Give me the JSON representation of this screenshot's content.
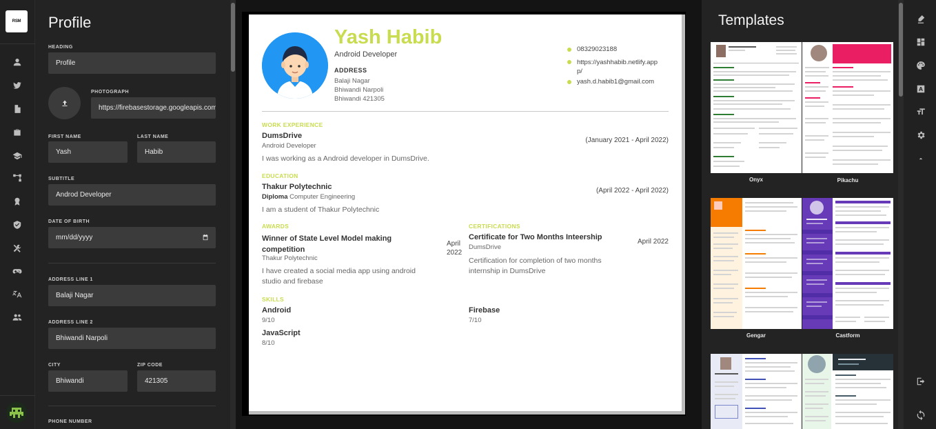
{
  "form": {
    "title": "Profile",
    "heading_label": "HEADING",
    "heading_value": "Profile",
    "photo_label": "PHOTOGRAPH",
    "photo_value": "https://firebasestorage.googleapis.com",
    "first_name_label": "FIRST NAME",
    "first_name_value": "Yash",
    "last_name_label": "LAST NAME",
    "last_name_value": "Habib",
    "subtitle_label": "SUBTITLE",
    "subtitle_value": "Androd  Developer",
    "dob_label": "DATE OF BIRTH",
    "dob_placeholder": "mm/dd/yyyy",
    "addr1_label": "ADDRESS LINE 1",
    "addr1_value": "Balaji Nagar",
    "addr2_label": "ADDRESS LINE 2",
    "addr2_value": "Bhiwandi Narpoli",
    "city_label": "CITY",
    "city_value": "Bhiwandi",
    "zip_label": "ZIP CODE",
    "zip_value": "421305",
    "phone_label": "PHONE NUMBER"
  },
  "resume": {
    "name": "Yash Habib",
    "subtitle": "Android Developer",
    "address_heading": "ADDRESS",
    "address_lines": [
      "Balaji Nagar",
      "Bhiwandi Narpoli",
      "Bhiwandi 421305"
    ],
    "phone": "08329023188",
    "website_line1": "https://yashhabib.netlify.app",
    "website_line2": "p/",
    "email": "yash.d.habib1@gmail.com",
    "work": {
      "heading": "WORK EXPERIENCE",
      "company": "DumsDrive",
      "role": "Android Developer",
      "dates": "(January 2021 - April 2022)",
      "summary": "I was working as a Android developer in DumsDrive."
    },
    "education": {
      "heading": "EDUCATION",
      "institution": "Thakur Polytechnic",
      "degree_bold": "Diploma",
      "degree_rest": " Computer Engineering",
      "dates": "(April 2022 - April 2022)",
      "summary": "I am a student of Thakur Polytechnic"
    },
    "awards": {
      "heading": "AWARDS",
      "title_line1": "Winner of State Level Model making",
      "title_line2": "competition",
      "awarder": "Thakur Polytechnic",
      "date_line1": "April",
      "date_line2": "2022",
      "summary_line1": "I have created a social media app using android",
      "summary_line2": "studio and firebase"
    },
    "certifications": {
      "heading": "CERTIFICATIONS",
      "title": "Certificate for Two Months Inteership",
      "issuer": "DumsDrive",
      "date": "April 2022",
      "summary_line1": "Certification for completion of two months",
      "summary_line2": "internship in DumsDrive"
    },
    "skills": {
      "heading": "SKILLS",
      "items": [
        {
          "name": "Android",
          "level": "9/10"
        },
        {
          "name": "Firebase",
          "level": "7/10"
        },
        {
          "name": "JavaScript",
          "level": "8/10"
        }
      ]
    }
  },
  "templates": {
    "title": "Templates",
    "items": [
      "Onyx",
      "Pikachu",
      "Gengar",
      "Castform"
    ]
  },
  "colors": {
    "accent": "#c9dc4f",
    "panel": "#232323",
    "input": "#3b3b3b"
  }
}
